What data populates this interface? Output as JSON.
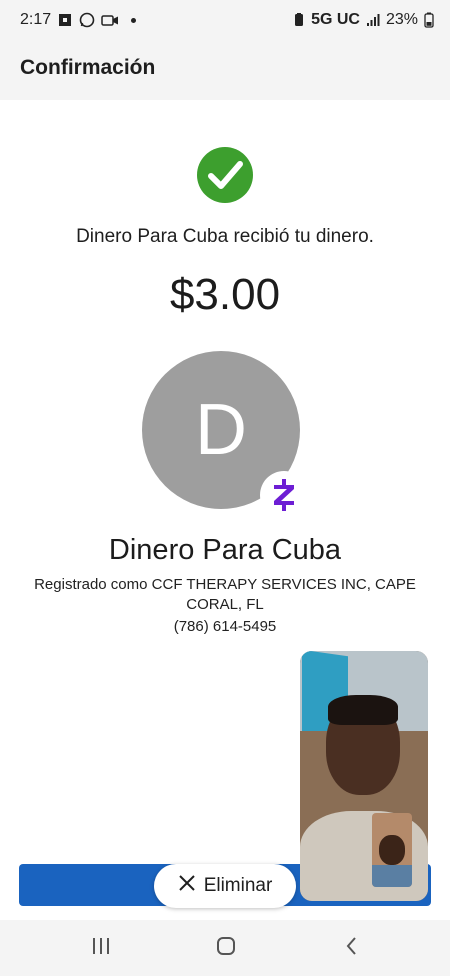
{
  "status_bar": {
    "time": "2:17",
    "network": "5G UC",
    "battery": "23%",
    "icons": [
      "chase-icon",
      "whatsapp-icon",
      "video-icon",
      "notification-dot",
      "battery-saver-icon",
      "signal-icon",
      "battery-icon"
    ]
  },
  "header": {
    "title": "Confirmación"
  },
  "confirmation": {
    "status_icon": "check-circle-icon",
    "message": "Dinero Para Cuba recibió tu dinero.",
    "amount": "$3.00"
  },
  "recipient": {
    "initial": "D",
    "badge_icon": "zelle-icon",
    "name": "Dinero Para Cuba",
    "registered_as": "Registrado como CCF THERAPY SERVICES INC, CAPE CORAL, FL",
    "phone": "(786) 614-5495"
  },
  "actions": {
    "remove_label": "Eliminar",
    "remove_icon": "close-icon"
  },
  "video_call": {
    "overlay": "video-call-preview",
    "self_view": "self-view-thumbnail"
  },
  "nav_bar": {
    "items": [
      "recents-icon",
      "home-icon",
      "back-icon"
    ]
  },
  "colors": {
    "success": "#3d9f2e",
    "primary": "#1a63bf",
    "zelle": "#6d1ed4",
    "avatar": "#9e9e9e"
  }
}
